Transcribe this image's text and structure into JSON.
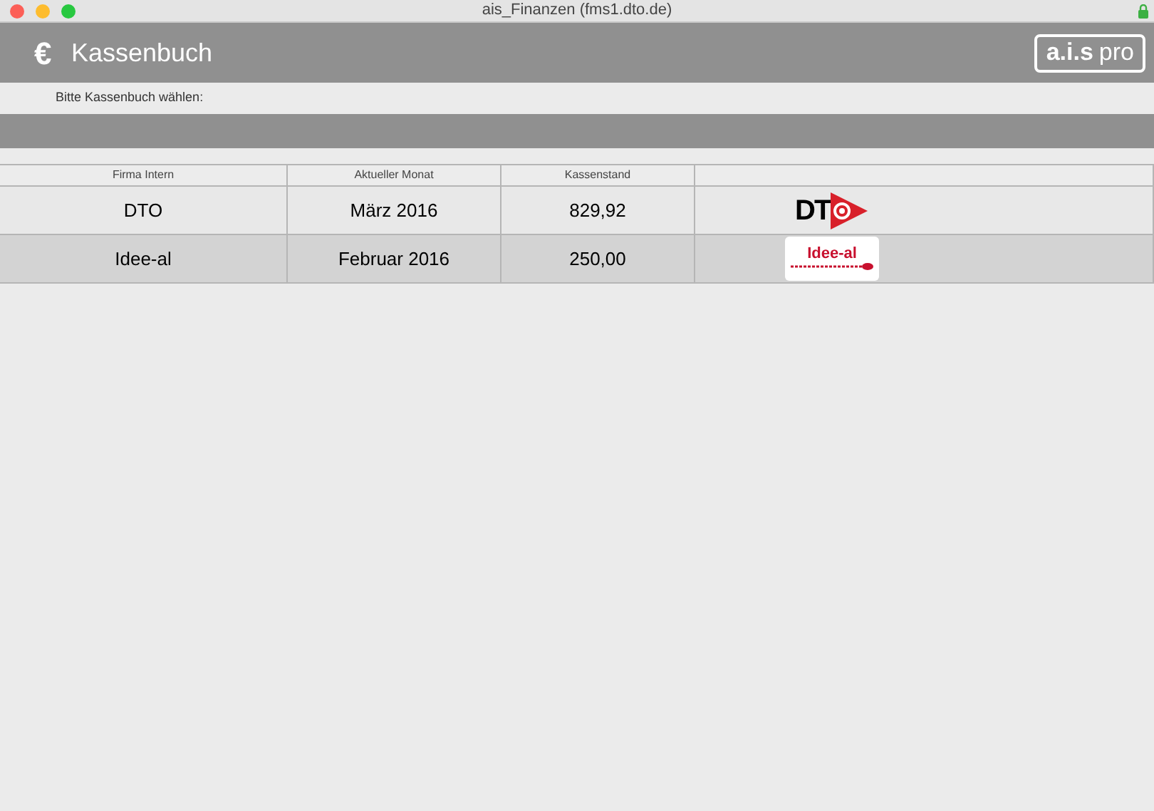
{
  "window": {
    "title": "ais_Finanzen (fms1.dto.de)"
  },
  "header": {
    "icon_text": "€",
    "title": "Kassenbuch",
    "brand_bold": "a.i.s",
    "brand_light": "pro"
  },
  "prompt": "Bitte Kassenbuch wählen:",
  "table": {
    "columns": [
      "Firma Intern",
      "Aktueller Monat",
      "Kassenstand"
    ],
    "rows": [
      {
        "firma": "DTO",
        "monat": "März 2016",
        "kassenstand": "829,92",
        "logo": {
          "kind": "triangle",
          "text": "DT"
        },
        "selected": false
      },
      {
        "firma": "Idee-al",
        "monat": "Februar 2016",
        "kassenstand": "250,00",
        "logo": {
          "kind": "card",
          "text": "Idee-al"
        },
        "selected": true
      }
    ]
  }
}
